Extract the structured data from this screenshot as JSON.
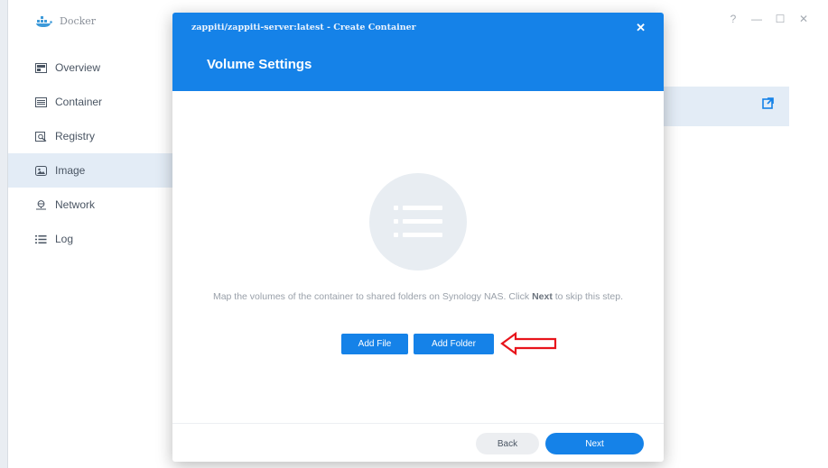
{
  "app": {
    "title": "Docker",
    "controls": {
      "help": "?",
      "minimize": "—",
      "maximize": "☐",
      "close": "✕"
    }
  },
  "sidebar": {
    "items": [
      {
        "label": "Overview",
        "icon": "overview-icon",
        "active": false
      },
      {
        "label": "Container",
        "icon": "container-icon",
        "active": false
      },
      {
        "label": "Registry",
        "icon": "registry-icon",
        "active": false
      },
      {
        "label": "Image",
        "icon": "image-icon",
        "active": true
      },
      {
        "label": "Network",
        "icon": "network-icon",
        "active": false
      },
      {
        "label": "Log",
        "icon": "log-icon",
        "active": false
      }
    ]
  },
  "modal": {
    "title": "zappiti/zappiti-server:latest - Create Container",
    "close": "✕",
    "subtitle": "Volume Settings",
    "description_pre": "Map the volumes of the container to shared folders on Synology NAS. Click ",
    "description_bold": "Next",
    "description_post": " to skip this step.",
    "add_file": "Add File",
    "add_folder": "Add Folder",
    "back": "Back",
    "next": "Next"
  },
  "colors": {
    "accent": "#1582e8",
    "annotation_arrow": "#e8141b",
    "active_row": "#e3ecf6"
  }
}
